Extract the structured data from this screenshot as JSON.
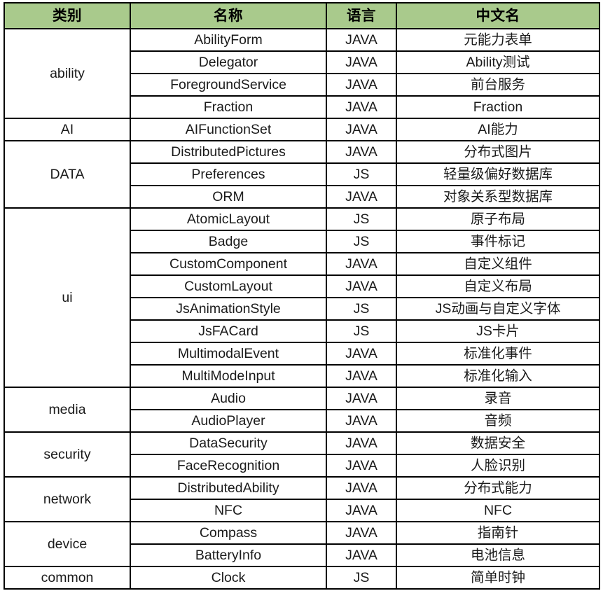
{
  "table": {
    "headers": [
      {
        "key": "category",
        "label": "类别"
      },
      {
        "key": "name",
        "label": "名称"
      },
      {
        "key": "language",
        "label": "语言"
      },
      {
        "key": "chinese_name",
        "label": "中文名"
      }
    ],
    "header_bg": "#a9ca8c",
    "border_color": "#000000",
    "groups": [
      {
        "category": "ability",
        "rows": [
          {
            "name": "AbilityForm",
            "language": "JAVA",
            "chinese_name": "元能力表单"
          },
          {
            "name": "Delegator",
            "language": "JAVA",
            "chinese_name": "Ability测试"
          },
          {
            "name": "ForegroundService",
            "language": "JAVA",
            "chinese_name": "前台服务"
          },
          {
            "name": "Fraction",
            "language": "JAVA",
            "chinese_name": "Fraction"
          }
        ]
      },
      {
        "category": "AI",
        "rows": [
          {
            "name": "AIFunctionSet",
            "language": "JAVA",
            "chinese_name": "AI能力"
          }
        ]
      },
      {
        "category": "DATA",
        "rows": [
          {
            "name": "DistributedPictures",
            "language": "JAVA",
            "chinese_name": "分布式图片"
          },
          {
            "name": "Preferences",
            "language": "JS",
            "chinese_name": "轻量级偏好数据库"
          },
          {
            "name": "ORM",
            "language": "JAVA",
            "chinese_name": "对象关系型数据库"
          }
        ]
      },
      {
        "category": "ui",
        "rows": [
          {
            "name": "AtomicLayout",
            "language": "JS",
            "chinese_name": "原子布局"
          },
          {
            "name": "Badge",
            "language": "JS",
            "chinese_name": "事件标记"
          },
          {
            "name": "CustomComponent",
            "language": "JAVA",
            "chinese_name": "自定义组件"
          },
          {
            "name": "CustomLayout",
            "language": "JAVA",
            "chinese_name": "自定义布局"
          },
          {
            "name": "JsAnimationStyle",
            "language": "JS",
            "chinese_name": "JS动画与自定义字体"
          },
          {
            "name": "JsFACard",
            "language": "JS",
            "chinese_name": "JS卡片"
          },
          {
            "name": "MultimodalEvent",
            "language": "JAVA",
            "chinese_name": "标准化事件"
          },
          {
            "name": "MultiModeInput",
            "language": "JAVA",
            "chinese_name": "标准化输入"
          }
        ]
      },
      {
        "category": "media",
        "rows": [
          {
            "name": "Audio",
            "language": "JAVA",
            "chinese_name": "录音"
          },
          {
            "name": "AudioPlayer",
            "language": "JAVA",
            "chinese_name": "音频"
          }
        ]
      },
      {
        "category": "security",
        "rows": [
          {
            "name": "DataSecurity",
            "language": "JAVA",
            "chinese_name": "数据安全"
          },
          {
            "name": "FaceRecognition",
            "language": "JAVA",
            "chinese_name": "人脸识别"
          }
        ]
      },
      {
        "category": "network",
        "rows": [
          {
            "name": "DistributedAbility",
            "language": "JAVA",
            "chinese_name": "分布式能力"
          },
          {
            "name": "NFC",
            "language": "JAVA",
            "chinese_name": "NFC"
          }
        ]
      },
      {
        "category": "device",
        "rows": [
          {
            "name": "Compass",
            "language": "JAVA",
            "chinese_name": "指南针"
          },
          {
            "name": "BatteryInfo",
            "language": "JAVA",
            "chinese_name": "电池信息"
          }
        ]
      },
      {
        "category": "common",
        "rows": [
          {
            "name": "Clock",
            "language": "JS",
            "chinese_name": "简单时钟"
          }
        ]
      }
    ]
  }
}
